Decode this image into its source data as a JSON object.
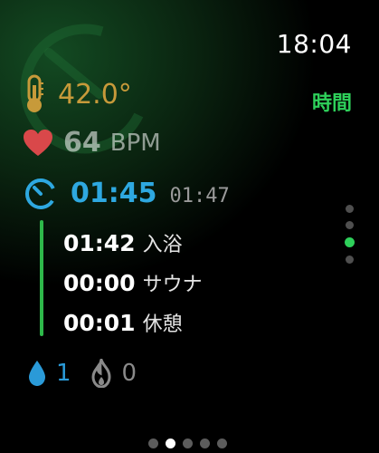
{
  "status_bar": {
    "time": "18:04"
  },
  "mode_label": "時間",
  "temperature": {
    "value": "42.0°",
    "icon": "thermometer-icon"
  },
  "heart_rate": {
    "value": "64",
    "unit": "BPM",
    "icon": "heart-icon"
  },
  "timer": {
    "main": "01:45",
    "secondary": "01:47",
    "icon": "timer-icon"
  },
  "phases": [
    {
      "time": "01:42",
      "name": "入浴"
    },
    {
      "time": "00:00",
      "name": "サウナ"
    },
    {
      "time": "00:01",
      "name": "休憩"
    }
  ],
  "counts": {
    "water": "1",
    "fire": "0"
  },
  "vertical_pager": {
    "count": 4,
    "active_index": 2
  },
  "horizontal_pager": {
    "count": 5,
    "active_index": 1
  },
  "colors": {
    "accent_green": "#2ed05a",
    "temperature_orange": "#c79a3a",
    "heart_red": "#d9484a",
    "timer_blue": "#2ea8e0",
    "water_blue": "#2a9ad8",
    "phase_line_green": "#2eb84a"
  }
}
